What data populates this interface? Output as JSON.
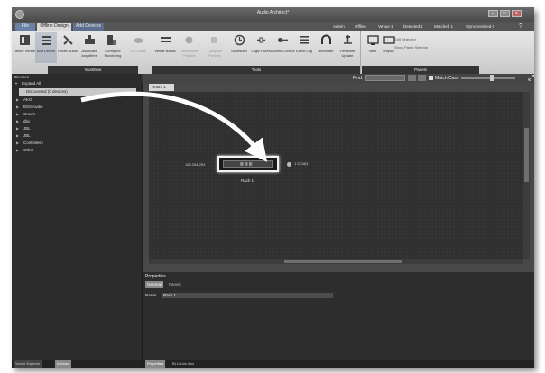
{
  "window": {
    "title": "Audio Architect*"
  },
  "menu": {
    "file": "File",
    "offline_design": "Offline Design",
    "add_devices": "Add Devices",
    "status": [
      "Admin",
      "Offline",
      "Venue 1",
      "Detected 1",
      "Matched 1",
      "Synchronized 0"
    ]
  },
  "ribbon": {
    "buttons": [
      "Define Venue",
      "Add Device",
      "Route Audio",
      "Associate Amplifiers",
      "Configure Monitoring",
      "Go Online",
      "Venue Backs",
      "Sequencer Presets",
      "Compact Presets",
      "Scheduler",
      "Logic Rules",
      "Access Control",
      "Event Log",
      "NetSetter",
      "Firmware Update",
      "New",
      "Import"
    ],
    "groups": {
      "workflow": "Workflow",
      "tools": "Tools",
      "panels": "Panels"
    },
    "panel_options": [
      "Edit Selected",
      "Show Panel Selector"
    ]
  },
  "find": {
    "label": "Find:",
    "match_case": "Match Case"
  },
  "devices": {
    "header": "Devices",
    "expand_all": "Expand All",
    "discovered": "Discovered (0 devices)",
    "brands": [
      "AKG",
      "BSS Audio",
      "Crown",
      "dbx",
      "JBL",
      "JBL",
      "Controllers",
      "Other"
    ]
  },
  "left_tabs": [
    "Venue Explorer",
    "Devices"
  ],
  "canvas": {
    "room_tab": "Room 1",
    "ip": "169.254.254",
    "device_name": "Rack 1",
    "port_label": "1  DCi8|4"
  },
  "properties": {
    "header": "Properties",
    "tabs": [
      "General",
      "Panels"
    ],
    "name_label": "Name",
    "name_value": "Rack 1"
  },
  "bottom_tabs": [
    "Properties",
    "BLU Link Bus"
  ]
}
